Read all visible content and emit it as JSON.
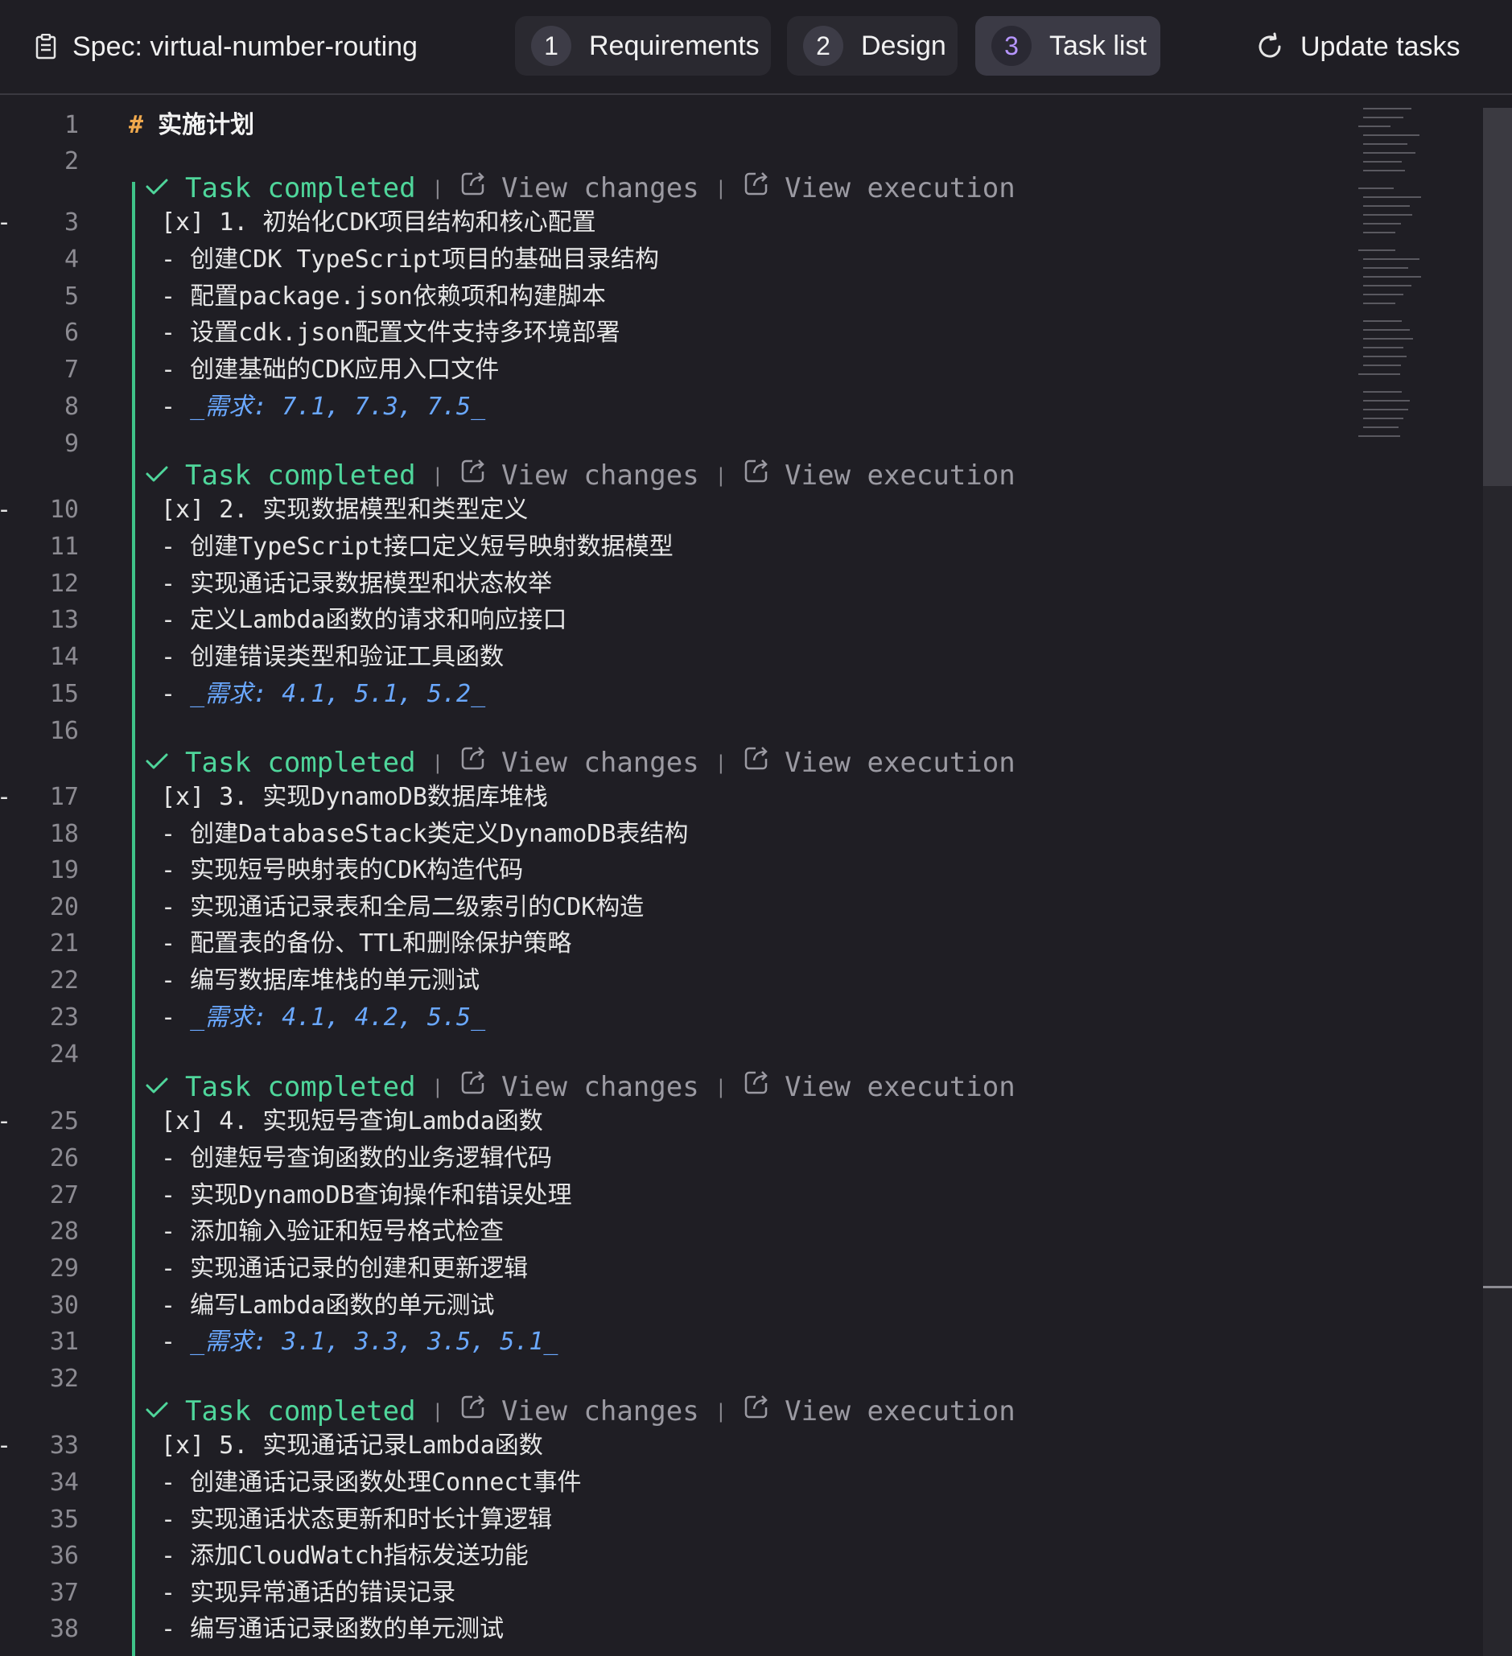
{
  "header": {
    "spec_title": "Spec: virtual-number-routing",
    "tabs": [
      {
        "num": "1",
        "label": "Requirements"
      },
      {
        "num": "2",
        "label": "Design"
      },
      {
        "num": "3",
        "label": "Task list"
      }
    ],
    "active_tab": "Task list",
    "update_label": "Update tasks"
  },
  "codelens": {
    "done": "Task completed",
    "sep": "|",
    "changes": "View changes",
    "execution": "View execution"
  },
  "lines": {
    "l1": {
      "hash": "#",
      "text": "实施计划"
    },
    "l3": "[x] 1. 初始化CDK项目结构和核心配置",
    "l4": "- 创建CDK TypeScript项目的基础目录结构",
    "l5": "- 配置package.json依赖项和构建脚本",
    "l6": "- 设置cdk.json配置文件支持多环境部署",
    "l7": "- 创建基础的CDK应用入口文件",
    "l8": "_需求: 7.1, 7.3, 7.5_",
    "l10": "[x] 2. 实现数据模型和类型定义",
    "l11": "- 创建TypeScript接口定义短号映射数据模型",
    "l12": "- 实现通话记录数据模型和状态枚举",
    "l13": "- 定义Lambda函数的请求和响应接口",
    "l14": "- 创建错误类型和验证工具函数",
    "l15": "_需求: 4.1, 5.1, 5.2_",
    "l17": "[x] 3. 实现DynamoDB数据库堆栈",
    "l18": "- 创建DatabaseStack类定义DynamoDB表结构",
    "l19": "- 实现短号映射表的CDK构造代码",
    "l20": "- 实现通话记录表和全局二级索引的CDK构造",
    "l21": "- 配置表的备份、TTL和删除保护策略",
    "l22": "- 编写数据库堆栈的单元测试",
    "l23": "_需求: 4.1, 4.2, 5.5_",
    "l25": "[x] 4. 实现短号查询Lambda函数",
    "l26": "- 创建短号查询函数的业务逻辑代码",
    "l27": "- 实现DynamoDB查询操作和错误处理",
    "l28": "- 添加输入验证和短号格式检查",
    "l29": "- 实现通话记录的创建和更新逻辑",
    "l30": "- 编写Lambda函数的单元测试",
    "l31": "_需求: 3.1, 3.3, 3.5, 5.1_",
    "l33": "[x] 5. 实现通话记录Lambda函数",
    "l34": "- 创建通话记录函数处理Connect事件",
    "l35": "- 实现通话状态更新和时长计算逻辑",
    "l36": "- 添加CloudWatch指标发送功能",
    "l37": "- 实现异常通话的错误记录",
    "l38": "- 编写通话记录函数的单元测试"
  },
  "line_numbers": [
    "1",
    "2",
    "3",
    "4",
    "5",
    "6",
    "7",
    "8",
    "9",
    "10",
    "11",
    "12",
    "13",
    "14",
    "15",
    "16",
    "17",
    "18",
    "19",
    "20",
    "21",
    "22",
    "23",
    "24",
    "25",
    "26",
    "27",
    "28",
    "29",
    "30",
    "31",
    "32",
    "33",
    "34",
    "35",
    "36",
    "37",
    "38"
  ],
  "colors": {
    "background": "#1f1e24",
    "task_completed": "#4fd69b",
    "requirement_ref": "#6aa8ff",
    "heading_hash": "#f0a94d",
    "active_tab_num": "#b695ff"
  }
}
